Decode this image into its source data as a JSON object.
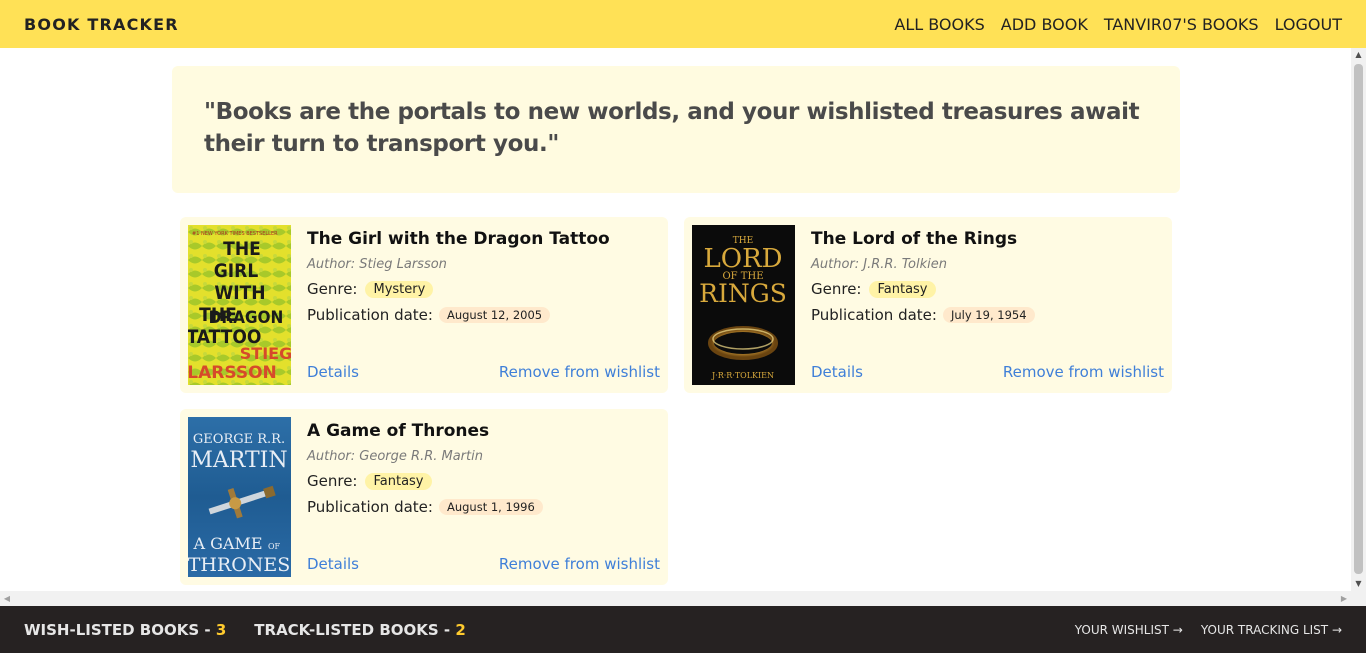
{
  "navbar": {
    "brand": "BOOK TRACKER",
    "links": [
      "ALL BOOKS",
      "ADD BOOK",
      "TANVIR07'S BOOKS",
      "LOGOUT"
    ]
  },
  "quote": "\"Books are the portals to new worlds, and your wishlisted treasures await their turn to transport you.\"",
  "books": [
    {
      "title": "The Girl with the Dragon Tattoo",
      "author": "Author: Stieg Larsson",
      "genre_label": "Genre:",
      "genre": "Mystery",
      "date_label": "Publication date:",
      "date": "August 12, 2005",
      "details": "Details",
      "remove": "Remove from wishlist",
      "cover": {
        "top": "#1 NEW YORK TIMES BESTSELLER",
        "title_lines": [
          "THE",
          "GIRL",
          "WITH",
          "THE",
          "DRAGON",
          "TATTOO"
        ],
        "author_lines": [
          "STIEG",
          "LARSSON"
        ]
      }
    },
    {
      "title": "The Lord of the Rings",
      "author": "Author: J.R.R. Tolkien",
      "genre_label": "Genre:",
      "genre": "Fantasy",
      "date_label": "Publication date:",
      "date": "July 19, 1954",
      "details": "Details",
      "remove": "Remove from wishlist",
      "cover": {
        "title_lines": [
          "THE",
          "LORD",
          "OF THE",
          "RINGS"
        ],
        "author": "J·R·R·TOLKIEN"
      }
    },
    {
      "title": "A Game of Thrones",
      "author": "Author: George R.R. Martin",
      "genre_label": "Genre:",
      "genre": "Fantasy",
      "date_label": "Publication date:",
      "date": "August 1, 1996",
      "details": "Details",
      "remove": "Remove from wishlist",
      "cover": {
        "author_lines": [
          "GEORGE R.R.",
          "MARTIN"
        ],
        "title_lines": [
          "A GAME",
          "OF",
          "THRONES"
        ]
      }
    }
  ],
  "footer": {
    "wish_label": "WISH-LISTED BOOKS - ",
    "wish_count": "3",
    "track_label": "TRACK-LISTED BOOKS - ",
    "track_count": "2",
    "wishlist_link": "YOUR WISHLIST →",
    "tracking_link": "YOUR TRACKING LIST →"
  },
  "colors": {
    "navbar_bg": "#ffe156",
    "card_bg": "#fffbe3",
    "link": "#3f7fd8",
    "footer_bg": "#262222",
    "footer_count": "#ffcb2e"
  }
}
